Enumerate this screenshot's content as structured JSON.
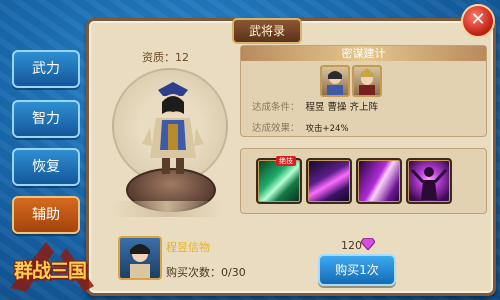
{
  "tabs": [
    {
      "label": "武力"
    },
    {
      "label": "智力"
    },
    {
      "label": "恢复"
    },
    {
      "label": "辅助",
      "active": true
    }
  ],
  "panel": {
    "title": "武将录",
    "aptitude": "资质：12"
  },
  "strategy": {
    "header": "密谋建计",
    "condition_label": "达成条件：",
    "condition_value": "程昱  曹操  齐上阵",
    "effect_label": "达成效果：",
    "effect_value": "攻击+24%"
  },
  "skills": {
    "badge": "绝技"
  },
  "item": {
    "name": "程昱信物",
    "purchase_count": "购买次数：0/30",
    "price": "120",
    "buy_label": "购买1次"
  },
  "logo": {
    "text": "群战三国"
  },
  "colors": {
    "accent": "#e6b422",
    "panel_bg": "#e9dcc0",
    "tab_active": "#d56b1f",
    "tab_inactive": "#14579a"
  }
}
